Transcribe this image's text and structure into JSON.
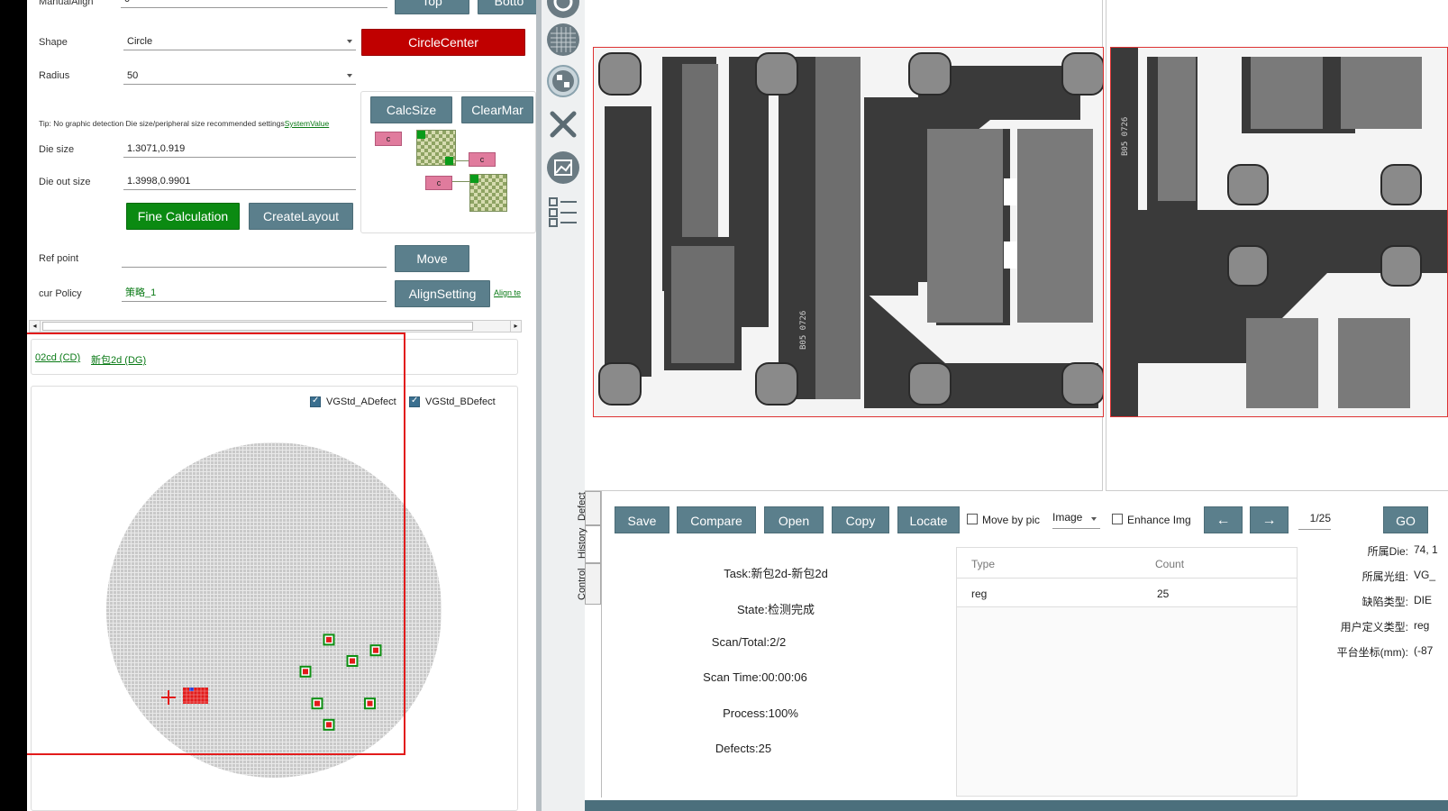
{
  "left": {
    "manual_align_label": "ManualAlign",
    "manual_align_value": "0",
    "top_btn": "Top",
    "bottom_btn": "Botto",
    "shape_label": "Shape",
    "shape_value": "Circle",
    "circle_center_btn": "CircleCenter",
    "radius_label": "Radius",
    "radius_value": "50",
    "calc_size_btn": "CalcSize",
    "clear_mark_btn": "ClearMar",
    "tip_text": "Tip: No graphic detection Die size/peripheral size recommended settings",
    "system_value_link": "SystemValue",
    "die_size_label": "Die size",
    "die_size_value": "1.3071,0.919",
    "die_out_size_label": "Die out size",
    "die_out_size_value": "1.3998,0.9901",
    "fine_calc_btn": "Fine Calculation",
    "create_layout_btn": "CreateLayout",
    "ref_point_label": "Ref point",
    "ref_point_value": "",
    "move_btn": "Move",
    "cur_policy_label": "cur Policy",
    "cur_policy_value": "策略_1",
    "align_setting_btn": "AlignSetting",
    "align_te_link": "Align te",
    "cell_label": "c",
    "breadcrumb_1": "02cd (CD)",
    "breadcrumb_2": "新包2d (DG)",
    "legend_a": "VGStd_ADefect",
    "legend_b": "VGStd_BDefect"
  },
  "bottom": {
    "tabs": [
      "Defect",
      "History",
      "Control"
    ],
    "save_btn": "Save",
    "compare_btn": "Compare",
    "open_btn": "Open",
    "copy_btn": "Copy",
    "locate_btn": "Locate",
    "move_by_pic": "Move by pic",
    "image_select": "Image",
    "enhance_img": "Enhance Img",
    "prev_btn": "←",
    "next_btn": "→",
    "page_value": "1/25",
    "go_btn": "GO",
    "task": "Task:新包2d-新包2d",
    "state": "State:检测完成",
    "scan_total": "Scan/Total:2/2",
    "scan_time": "Scan Time:00:00:06",
    "process": "Process:100%",
    "defects": "Defects:25",
    "table_headers": [
      "Type",
      "Count"
    ],
    "table_rows": [
      [
        "reg",
        "25"
      ]
    ],
    "right_labels": [
      "所属Die:",
      "所属光组:",
      "缺陷类型:",
      "用户定义类型:",
      "平台坐标(mm):"
    ],
    "right_values": [
      "74, 1",
      "VG_",
      "DIE",
      "reg",
      "(-87"
    ]
  },
  "viewer": {
    "die_mark_text": "B05 0726"
  },
  "wafer": {
    "defects": [
      {
        "col": 37,
        "row": 36
      },
      {
        "col": 41,
        "row": 40
      },
      {
        "col": 45,
        "row": 38
      },
      {
        "col": 33,
        "row": 42
      },
      {
        "col": 35,
        "row": 48
      },
      {
        "col": 44,
        "row": 48
      },
      {
        "col": 37,
        "row": 52
      }
    ],
    "colors": {
      "die": "#c9c9c9",
      "grid": "#e9e9e9",
      "defect_outer": "#0e8f13",
      "defect_inner": "#e21b1b"
    }
  }
}
